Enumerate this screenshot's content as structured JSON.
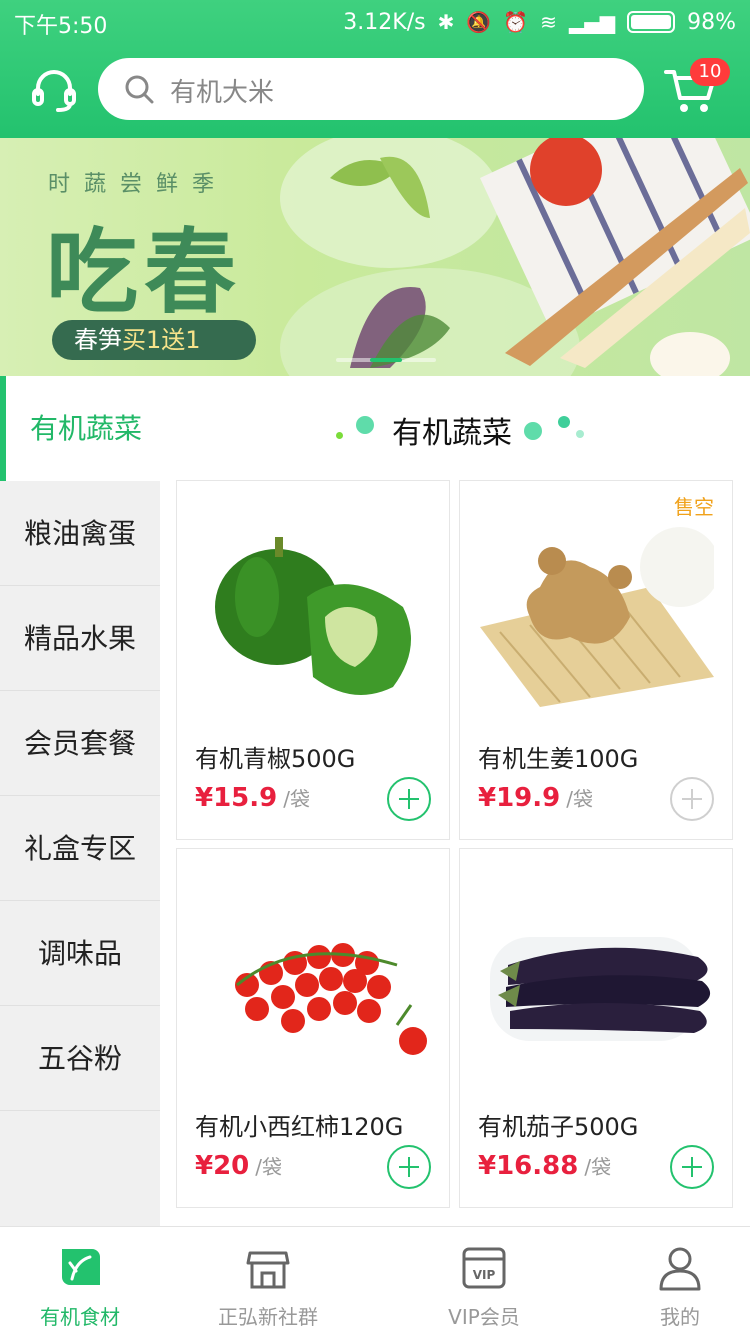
{
  "status_bar": {
    "time": "下午5:50",
    "net_speed": "3.12K/s",
    "battery": "98%"
  },
  "header": {
    "search_placeholder": "有机大米",
    "cart_count": "10",
    "icons": [
      "headset-icon",
      "search-icon",
      "cart-icon"
    ]
  },
  "banner": {
    "subtitle": "时蔬尝鲜季",
    "headline": "吃春",
    "promo_prefix": "春笋",
    "promo_highlight": "买1送1"
  },
  "categories": [
    {
      "label": "有机蔬菜",
      "active": true
    },
    {
      "label": "粮油禽蛋",
      "active": false
    },
    {
      "label": "精品水果",
      "active": false
    },
    {
      "label": "会员套餐",
      "active": false
    },
    {
      "label": "礼盒专区",
      "active": false
    },
    {
      "label": "调味品",
      "active": false
    },
    {
      "label": "五谷粉",
      "active": false
    }
  ],
  "section": {
    "title": "有机蔬菜"
  },
  "products": [
    {
      "name": "有机青椒500G",
      "price": "¥15.9",
      "unit": "/袋",
      "sold_out": false,
      "image": "green-pepper-image"
    },
    {
      "name": "有机生姜100G",
      "price": "¥19.9",
      "unit": "/袋",
      "sold_out": true,
      "sold_out_label": "售空",
      "image": "ginger-image"
    },
    {
      "name": "有机小西红柿120G",
      "price": "¥20",
      "unit": "/袋",
      "sold_out": false,
      "image": "cherry-tomato-image"
    },
    {
      "name": "有机茄子500G",
      "price": "¥16.88",
      "unit": "/袋",
      "sold_out": false,
      "image": "eggplant-image"
    }
  ],
  "tabbar": [
    {
      "label": "有机食材",
      "icon": "leaf-icon",
      "active": true
    },
    {
      "label": "正弘新社群",
      "icon": "store-icon",
      "active": false
    },
    {
      "label": "VIP会员",
      "icon": "vip-card-icon",
      "active": false
    },
    {
      "label": "我的",
      "icon": "user-icon",
      "active": false
    }
  ],
  "colors": {
    "brand_green": "#23c26e",
    "price_red": "#e8203e",
    "sold_out_orange": "#f0a21c",
    "badge_red": "#ff3b3b"
  }
}
